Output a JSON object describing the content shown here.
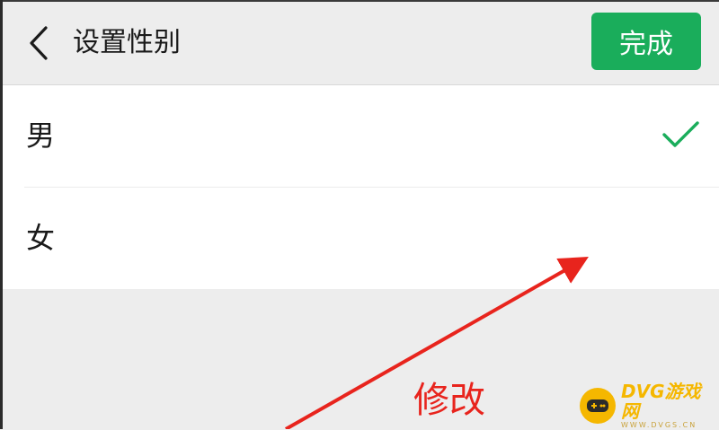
{
  "header": {
    "title": "设置性别",
    "back_icon": "chevron-left-icon",
    "done_label": "完成",
    "done_color": "#1aad5b"
  },
  "options": [
    {
      "label": "男",
      "selected": true
    },
    {
      "label": "女",
      "selected": false
    }
  ],
  "selected_check_icon": "check-icon",
  "check_color": "#1aad5b",
  "annotation": {
    "text": "修改",
    "color": "#e8241d"
  },
  "watermark": {
    "text": "DVG游戏网",
    "subtext": "WWW.DVGS.CN",
    "color": "#f5b700"
  }
}
